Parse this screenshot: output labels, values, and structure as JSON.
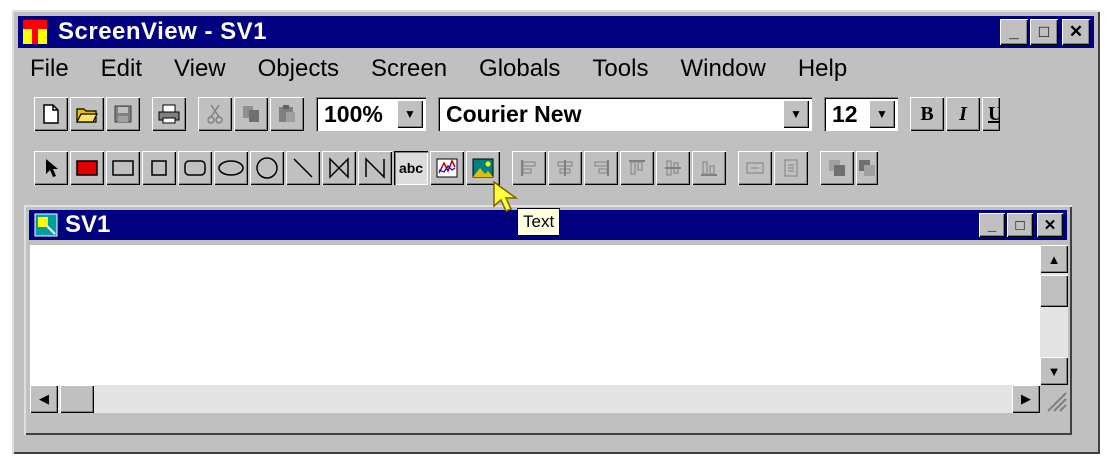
{
  "window": {
    "title": "ScreenView - SV1"
  },
  "menu": [
    "File",
    "Edit",
    "View",
    "Objects",
    "Screen",
    "Globals",
    "Tools",
    "Window",
    "Help"
  ],
  "toolbar1": {
    "zoom": "100%",
    "font": "Courier New",
    "size": "12",
    "bold": "B",
    "italic": "I",
    "underline": "U"
  },
  "toolbar2": {
    "text_tool_glyph": "abc",
    "active_tool": "text-tool"
  },
  "tooltip": {
    "text": "Text"
  },
  "child": {
    "title": "SV1"
  },
  "colors": {
    "titlebar": "#000080",
    "face": "#c0c0c0",
    "tooltip_bg": "#ffffe1",
    "rect_fill": "#e00000"
  },
  "icons": [
    "new-file-icon",
    "open-folder-icon",
    "save-icon",
    "print-icon",
    "cut-icon",
    "copy-icon",
    "paste-icon",
    "pointer-icon",
    "filled-rect-icon",
    "rect-icon",
    "square-icon",
    "rounded-rect-icon",
    "ellipse-icon",
    "circle-icon",
    "line-icon",
    "bowtie-icon",
    "polyline-icon",
    "text-tool-icon",
    "trend-icon",
    "bitmap-icon",
    "align-left-icon",
    "align-center-icon",
    "align-right-icon",
    "align-top-icon",
    "align-middle-icon",
    "align-bottom-icon",
    "space-horizontal-icon",
    "space-vertical-icon",
    "to-front-icon",
    "to-back-icon"
  ]
}
